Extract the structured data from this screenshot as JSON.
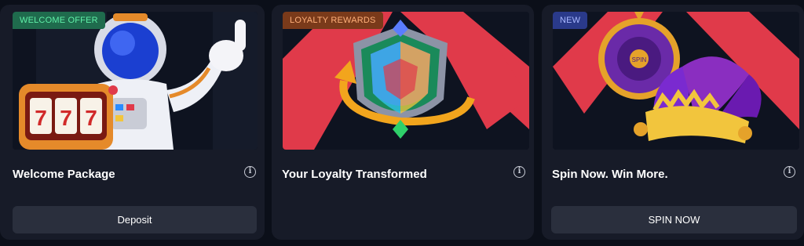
{
  "cards": [
    {
      "badge": "WELCOME OFFER",
      "badge_color": "#1f6b4d",
      "title": "Welcome Package",
      "info_icon": "info-icon",
      "button_label": "Deposit",
      "image": "astronaut-slot-machine-illustration"
    },
    {
      "badge": "LOYALTY REWARDS",
      "badge_color": "#7a3a1a",
      "title": "Your Loyalty Transformed",
      "info_icon": "info-icon",
      "button_label": "",
      "image": "rainbow-shield-illustration"
    },
    {
      "badge": "NEW",
      "badge_color": "#2a3a8a",
      "title": "Spin Now. Win More.",
      "info_icon": "info-icon",
      "button_label": "SPIN NOW",
      "image": "jester-hat-prize-wheel-illustration"
    }
  ],
  "colors": {
    "background": "#0b0f19",
    "card": "#171b28",
    "button": "#2a2f3d",
    "accent_red": "#e03a4a"
  }
}
